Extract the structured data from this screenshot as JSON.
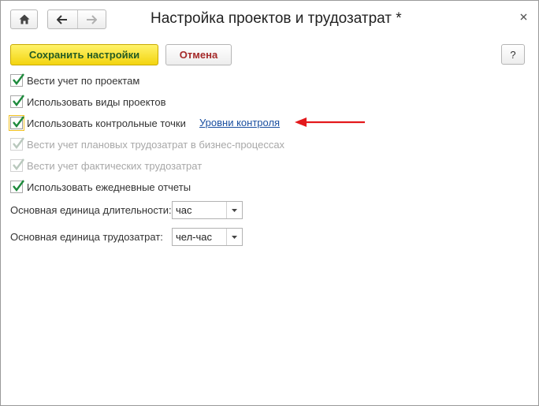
{
  "window": {
    "title": "Настройка проектов и трудозатрат *"
  },
  "toolbar": {
    "save_label": "Сохранить настройки",
    "cancel_label": "Отмена",
    "help_label": "?"
  },
  "checkboxes": [
    {
      "label": "Вести учет по проектам",
      "checked": true,
      "enabled": true
    },
    {
      "label": "Использовать виды проектов",
      "checked": true,
      "enabled": true
    },
    {
      "label": "Использовать контрольные точки",
      "checked": true,
      "enabled": true,
      "focused": true
    },
    {
      "label": "Вести учет плановых трудозатрат в бизнес-процессах",
      "checked": true,
      "enabled": false
    },
    {
      "label": "Вести учет фактических трудозатрат",
      "checked": true,
      "enabled": false
    },
    {
      "label": "Использовать ежедневные отчеты",
      "checked": true,
      "enabled": true
    }
  ],
  "control_levels_link": "Уровни контроля",
  "fields": {
    "duration_unit": {
      "label": "Основная единица длительности:",
      "value": "час"
    },
    "labor_unit": {
      "label": "Основная единица трудозатрат:",
      "value": "чел-час"
    }
  },
  "colors": {
    "check_green": "#1e8a3c",
    "save_yellow": "#f3d40f",
    "link_blue": "#1a4fa0",
    "arrow_red": "#e3191c",
    "cancel_text": "#a52a2a"
  },
  "icons": {
    "home": "home-icon",
    "back": "arrow-left-icon",
    "forward": "arrow-right-icon",
    "close": "close-icon",
    "dropdown": "chevron-down-icon",
    "check": "check-icon"
  }
}
